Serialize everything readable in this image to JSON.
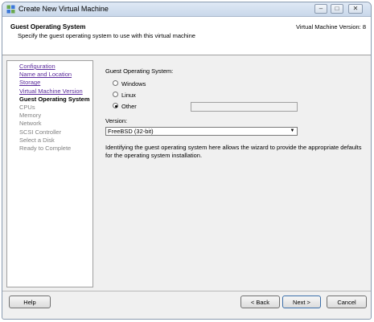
{
  "window": {
    "title": "Create New Virtual Machine",
    "controls": {
      "minimize": "–",
      "maximize": "□",
      "close": "✕"
    }
  },
  "header": {
    "title": "Guest Operating System",
    "subtitle": "Specify the guest operating system to use with this virtual machine",
    "version": "Virtual Machine Version: 8"
  },
  "nav": {
    "items": [
      {
        "label": "Configuration",
        "state": "link"
      },
      {
        "label": "Name and Location",
        "state": "link"
      },
      {
        "label": "Storage",
        "state": "link"
      },
      {
        "label": "Virtual Machine Version",
        "state": "link"
      },
      {
        "label": "Guest Operating System",
        "state": "active"
      },
      {
        "label": "CPUs",
        "state": "disabled"
      },
      {
        "label": "Memory",
        "state": "disabled"
      },
      {
        "label": "Network",
        "state": "disabled"
      },
      {
        "label": "SCSI Controller",
        "state": "disabled"
      },
      {
        "label": "Select a Disk",
        "state": "disabled"
      },
      {
        "label": "Ready to Complete",
        "state": "disabled"
      }
    ]
  },
  "content": {
    "os_label": "Guest Operating System:",
    "options": [
      {
        "label": "Windows",
        "selected": false
      },
      {
        "label": "Linux",
        "selected": false
      },
      {
        "label": "Other",
        "selected": true
      }
    ],
    "other_value": "",
    "version_label": "Version:",
    "version_value": "FreeBSD (32-bit)",
    "description": "Identifying the guest operating system here allows the wizard to provide the appropriate defaults for the operating system installation."
  },
  "buttons": {
    "help": "Help",
    "back": "< Back",
    "next": "Next >",
    "cancel": "Cancel"
  }
}
